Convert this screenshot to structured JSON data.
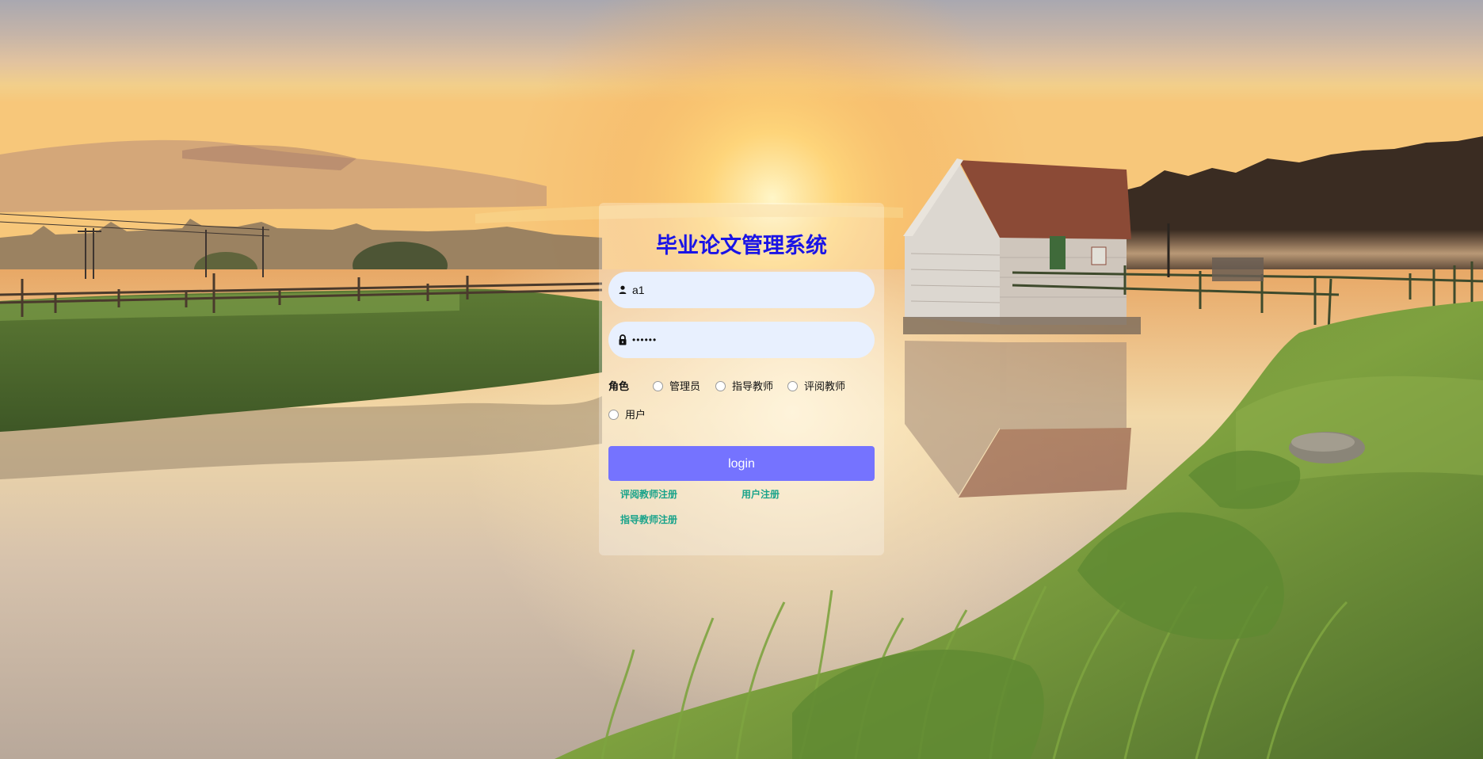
{
  "login": {
    "title": "毕业论文管理系统",
    "username_value": "a1",
    "password_value": "••••••",
    "role_label": "角色",
    "roles": [
      "管理员",
      "指导教师",
      "评阅教师",
      "用户"
    ],
    "login_label": "login",
    "links": {
      "reviewer_register": "评阅教师注册",
      "user_register": "用户注册",
      "advisor_register": "指导教师注册"
    }
  },
  "colors": {
    "title": "#1a14e6",
    "button": "#7573ff",
    "link": "#19a38a",
    "input_bg": "#e8f0fe"
  },
  "icons": {
    "username": "user-icon",
    "password": "lock-icon"
  }
}
